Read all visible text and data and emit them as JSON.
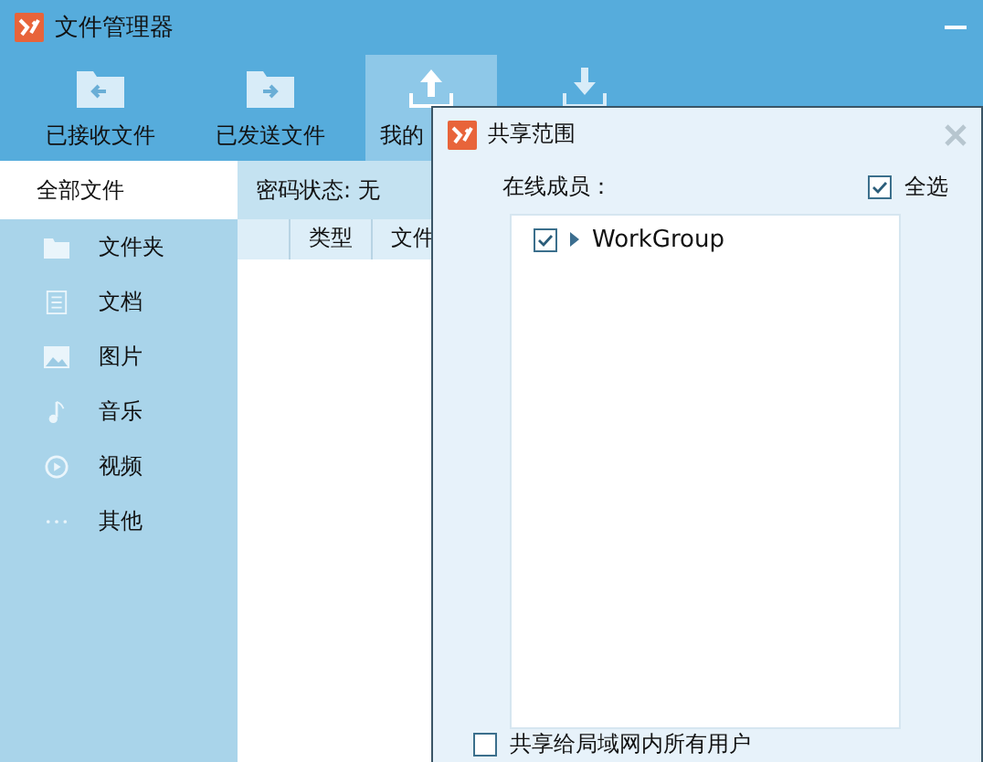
{
  "window": {
    "title": "文件管理器"
  },
  "toolbar": [
    {
      "kind": "receive",
      "label": "已接收文件",
      "selected": false
    },
    {
      "kind": "send",
      "label": "已发送文件",
      "selected": false
    },
    {
      "kind": "upload",
      "label": "我的",
      "selected": true
    },
    {
      "kind": "download",
      "selected": false
    }
  ],
  "sidebar": {
    "header": {
      "label": "全部文件",
      "selected": true
    },
    "items": [
      {
        "kind": "folder",
        "label": "文件夹",
        "selected": false
      },
      {
        "kind": "document",
        "label": "文档",
        "selected": false
      },
      {
        "kind": "image",
        "label": "图片",
        "selected": false
      },
      {
        "kind": "music",
        "label": "音乐",
        "selected": false
      },
      {
        "kind": "video",
        "label": "视频",
        "selected": false
      },
      {
        "kind": "more",
        "label": "其他",
        "selected": false
      }
    ]
  },
  "content": {
    "status": "密码状态: 无",
    "columns": [
      "类型",
      "文件"
    ]
  },
  "dialog": {
    "title": "共享范围",
    "members_label": "在线成员：",
    "select_all": {
      "label": "全选",
      "checked": true
    },
    "members": [
      {
        "label": "WorkGroup",
        "checked": true,
        "expanded": false
      }
    ],
    "share_all": {
      "label": "共享给局域网内所有用户",
      "checked": false
    }
  }
}
